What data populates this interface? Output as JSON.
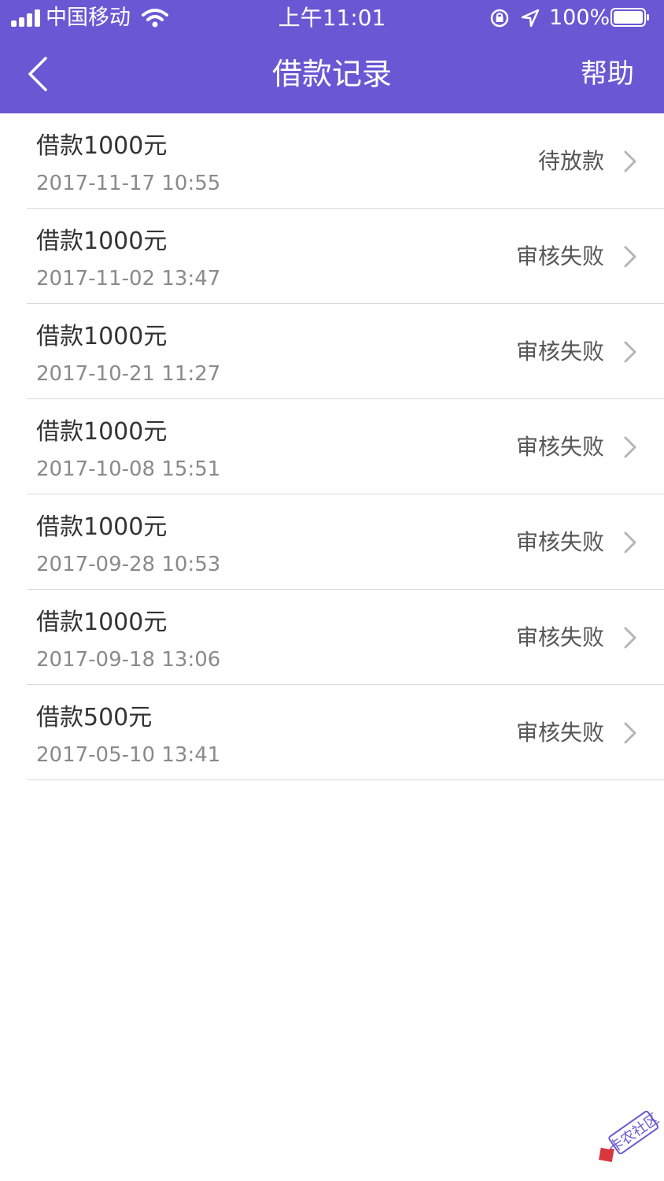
{
  "status_bar": {
    "carrier": "中国移动",
    "time": "上午11:01",
    "battery": "100%"
  },
  "nav": {
    "title": "借款记录",
    "help_label": "帮助",
    "back_icon": "chevron-left-icon"
  },
  "records": [
    {
      "title": "借款1000元",
      "date": "2017-11-17 10:55",
      "status": "待放款"
    },
    {
      "title": "借款1000元",
      "date": "2017-11-02 13:47",
      "status": "审核失败"
    },
    {
      "title": "借款1000元",
      "date": "2017-10-21 11:27",
      "status": "审核失败"
    },
    {
      "title": "借款1000元",
      "date": "2017-10-08 15:51",
      "status": "审核失败"
    },
    {
      "title": "借款1000元",
      "date": "2017-09-28 10:53",
      "status": "审核失败"
    },
    {
      "title": "借款1000元",
      "date": "2017-09-18 13:06",
      "status": "审核失败"
    },
    {
      "title": "借款500元",
      "date": "2017-05-10 13:41",
      "status": "审核失败"
    }
  ],
  "watermark": {
    "text": "卡农社区"
  },
  "colors": {
    "header_bg": "#6a57d4",
    "separator": "#d9d9d9",
    "status_text": "#555555",
    "date_text": "#8a8a8a"
  }
}
